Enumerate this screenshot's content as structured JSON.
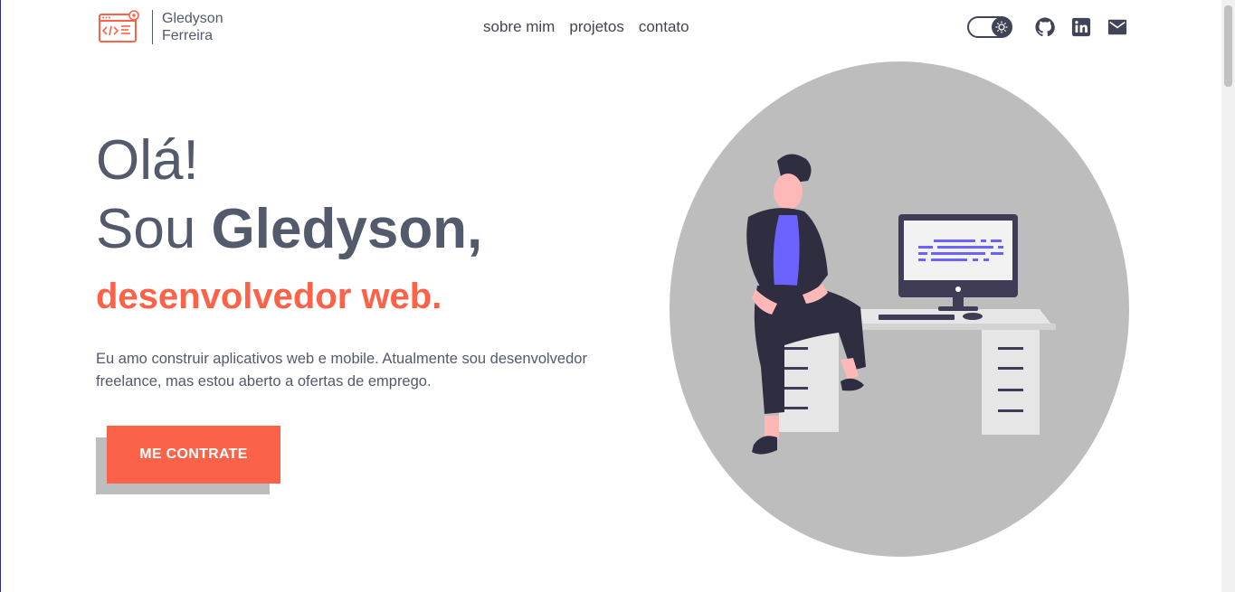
{
  "header": {
    "logo_line1": "Gledyson",
    "logo_line2": "Ferreira",
    "nav": [
      "sobre mim",
      "projetos",
      "contato"
    ],
    "icons": [
      "theme-toggle",
      "github-icon",
      "linkedin-icon",
      "mail-icon"
    ]
  },
  "hero": {
    "greeting": "Olá!",
    "intro_prefix": "Sou ",
    "name": "Gledyson,",
    "role": "desenvolvedor web.",
    "description": "Eu amo construir aplicativos web e mobile. Atualmente sou desenvolvedor freelance, mas estou aberto a ofertas de emprego.",
    "cta_label": "ME CONTRATE"
  },
  "colors": {
    "accent": "#fb6247",
    "text": "#525a6b",
    "dark": "#3f4556",
    "circle": "#bdbdbd",
    "code": "#6c63ff"
  }
}
